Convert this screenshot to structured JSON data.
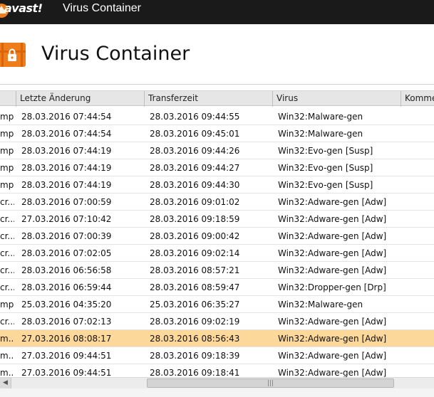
{
  "window": {
    "brand": "avast!",
    "title": "Virus Container"
  },
  "page": {
    "title": "Virus Container"
  },
  "table": {
    "columns": [
      {
        "key": "c0",
        "label": ""
      },
      {
        "key": "modified",
        "label": "Letzte Änderung"
      },
      {
        "key": "transfer",
        "label": "Transferzeit"
      },
      {
        "key": "virus",
        "label": "Virus"
      },
      {
        "key": "comment",
        "label": "Komme"
      }
    ],
    "rows": [
      {
        "c0": "mp",
        "modified": "28.03.2016 07:44:54",
        "transfer": "28.03.2016 09:44:55",
        "virus": "Win32:Malware-gen",
        "comment": ""
      },
      {
        "c0": "mp",
        "modified": "28.03.2016 07:44:54",
        "transfer": "28.03.2016 09:45:01",
        "virus": "Win32:Malware-gen",
        "comment": ""
      },
      {
        "c0": "mp",
        "modified": "28.03.2016 07:44:19",
        "transfer": "28.03.2016 09:44:26",
        "virus": "Win32:Evo-gen [Susp]",
        "comment": ""
      },
      {
        "c0": "mp",
        "modified": "28.03.2016 07:44:19",
        "transfer": "28.03.2016 09:44:27",
        "virus": "Win32:Evo-gen [Susp]",
        "comment": ""
      },
      {
        "c0": "mp",
        "modified": "28.03.2016 07:44:19",
        "transfer": "28.03.2016 09:44:30",
        "virus": "Win32:Evo-gen [Susp]",
        "comment": ""
      },
      {
        "c0": "cr...",
        "modified": "28.03.2016 07:00:59",
        "transfer": "28.03.2016 09:01:02",
        "virus": "Win32:Adware-gen [Adw]",
        "comment": ""
      },
      {
        "c0": "cr...",
        "modified": "27.03.2016 07:10:42",
        "transfer": "28.03.2016 09:18:59",
        "virus": "Win32:Adware-gen [Adw]",
        "comment": ""
      },
      {
        "c0": "cr...",
        "modified": "28.03.2016 07:00:39",
        "transfer": "28.03.2016 09:00:42",
        "virus": "Win32:Adware-gen [Adw]",
        "comment": ""
      },
      {
        "c0": "cr...",
        "modified": "28.03.2016 07:02:05",
        "transfer": "28.03.2016 09:02:14",
        "virus": "Win32:Adware-gen [Adw]",
        "comment": ""
      },
      {
        "c0": "cr...",
        "modified": "28.03.2016 06:56:58",
        "transfer": "28.03.2016 08:57:21",
        "virus": "Win32:Adware-gen [Adw]",
        "comment": ""
      },
      {
        "c0": "cr...",
        "modified": "28.03.2016 06:59:44",
        "transfer": "28.03.2016 08:59:47",
        "virus": "Win32:Dropper-gen [Drp]",
        "comment": ""
      },
      {
        "c0": "mp",
        "modified": "25.03.2016 04:35:20",
        "transfer": "25.03.2016 06:35:27",
        "virus": "Win32:Malware-gen",
        "comment": ""
      },
      {
        "c0": "cr...",
        "modified": "28.03.2016 07:02:13",
        "transfer": "28.03.2016 09:02:19",
        "virus": "Win32:Adware-gen [Adw]",
        "comment": ""
      },
      {
        "c0": "m...",
        "modified": "27.03.2016 08:08:17",
        "transfer": "28.03.2016 08:56:43",
        "virus": "Win32:Adware-gen [Adw]",
        "comment": "",
        "selected": true
      },
      {
        "c0": "m...",
        "modified": "27.03.2016 09:44:51",
        "transfer": "28.03.2016 09:18:39",
        "virus": "Win32:Adware-gen [Adw]",
        "comment": ""
      },
      {
        "c0": "m...",
        "modified": "27.03.2016 09:44:51",
        "transfer": "28.03.2016 09:18:41",
        "virus": "Win32:Adware-gen [Adw]",
        "comment": ""
      }
    ]
  },
  "scrollbar": {
    "left_arrow": "◀",
    "grip": "|||"
  },
  "colors": {
    "titlebar": "#1a1a1a",
    "accent_orange": "#f07d1c",
    "selected_row": "#fcd89a",
    "header_bg": "#e6e6e6"
  },
  "icons": {
    "brand_logo": "avast-logo-icon",
    "container": "treasure-chest-lock-icon"
  }
}
